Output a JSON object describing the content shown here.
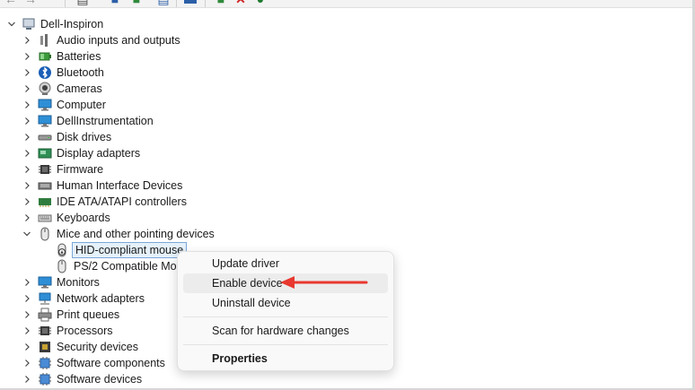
{
  "window": {
    "computer_name": "Dell-Inspiron"
  },
  "toolbar": {
    "buttons": [
      "back-icon",
      "forward-icon",
      "properties-icon",
      "update-driver-icon",
      "scan-icon",
      "help-icon",
      "add-driver-icon",
      "uninstall-icon",
      "enable-icon"
    ]
  },
  "tree": {
    "root_label": "Dell-Inspiron",
    "categories": [
      {
        "label": "Audio inputs and outputs",
        "icon": "speaker-icon"
      },
      {
        "label": "Batteries",
        "icon": "battery-icon"
      },
      {
        "label": "Bluetooth",
        "icon": "bluetooth-icon"
      },
      {
        "label": "Cameras",
        "icon": "camera-icon"
      },
      {
        "label": "Computer",
        "icon": "monitor-icon"
      },
      {
        "label": "DellInstrumentation",
        "icon": "monitor-icon"
      },
      {
        "label": "Disk drives",
        "icon": "disk-icon"
      },
      {
        "label": "Display adapters",
        "icon": "display-icon"
      },
      {
        "label": "Firmware",
        "icon": "chip-icon"
      },
      {
        "label": "Human Interface Devices",
        "icon": "hid-icon"
      },
      {
        "label": "IDE ATA/ATAPI controllers",
        "icon": "controller-icon"
      },
      {
        "label": "Keyboards",
        "icon": "keyboard-icon"
      },
      {
        "label": "Mice and other pointing devices",
        "icon": "mouse-icon"
      },
      {
        "label": "Monitors",
        "icon": "monitor-icon"
      },
      {
        "label": "Network adapters",
        "icon": "network-icon"
      },
      {
        "label": "Print queues",
        "icon": "printer-icon"
      },
      {
        "label": "Processors",
        "icon": "chip-icon"
      },
      {
        "label": "Security devices",
        "icon": "security-icon"
      },
      {
        "label": "Software components",
        "icon": "component-icon"
      },
      {
        "label": "Software devices",
        "icon": "component-icon"
      }
    ],
    "mice_children": [
      {
        "label": "HID-compliant mouse",
        "selected": true,
        "disabled": true
      },
      {
        "label": "PS/2 Compatible Mou"
      }
    ]
  },
  "context_menu": {
    "items": [
      {
        "label": "Update driver"
      },
      {
        "label": "Enable device",
        "highlighted": true
      },
      {
        "label": "Uninstall device"
      },
      {
        "label": "Scan for hardware changes"
      },
      {
        "label": "Properties",
        "bold": true
      }
    ]
  },
  "colors": {
    "accent_arrow": "#e8382f",
    "selection": "#e5f1fb",
    "selection_border": "#7aa7d8",
    "menu_bg": "#f9f9f9"
  }
}
